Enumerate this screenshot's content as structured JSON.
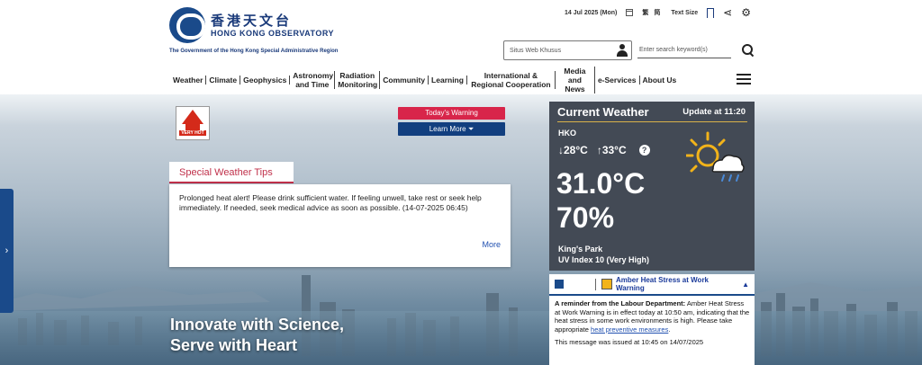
{
  "header": {
    "logo_cn": "香港天文台",
    "logo_en": "HONG KONG OBSERVATORY",
    "gov_line": "The Government of the Hong Kong Special Administrative Region",
    "date": "14 Jul 2025 (Mon)",
    "lang": "繁 简",
    "text_size": "Text Size",
    "site_search_placeholder": "Situs Web Khusus",
    "keyword_search_placeholder": "Enter search keyword(s)"
  },
  "nav": [
    "Weather",
    "Climate",
    "Geophysics",
    "Astronomy and Time",
    "Radiation Monitoring",
    "Community",
    "Learning",
    "International & Regional Cooperation",
    "Media and News",
    "e-Services",
    "About Us"
  ],
  "warning": {
    "icon_label": "VERY HOT",
    "todays_warning": "Today's Warning",
    "learn_more": "Learn More ⏷"
  },
  "tips": {
    "title": "Special Weather Tips",
    "text": "Prolonged heat alert! Please drink sufficient water. If feeling unwell, take rest or seek help immediately. If needed, seek medical advice as soon as possible. (14-07-2025 06:45)",
    "more": "More"
  },
  "slogan": {
    "line1": "Innovate with Science,",
    "line2": "Serve with Heart"
  },
  "weather": {
    "title": "Current Weather",
    "update": "Update at 11:20",
    "location": "HKO",
    "min": "↓28°C",
    "max": "↑33°C",
    "temperature": "31.0°C",
    "humidity": "70%",
    "station": "King's Park",
    "uv": "UV Index 10 (Very High)",
    "icon": "sun-cloud-rain-icon"
  },
  "notice": {
    "title": "Amber Heat Stress at Work Warning",
    "body_bold": "A reminder from the Labour Department:",
    "body": " Amber Heat Stress at Work Warning is in effect today at 10:50 am, indicating that the heat stress in some work environments is high. Please take appropriate ",
    "link": "heat preventive measures",
    "body_end": ".",
    "issued": "This message was issued at 10:45 on 14/07/2025"
  },
  "colors": {
    "brand": "#1a4a8a",
    "warning_red": "#d8254a",
    "panel": "#434a55",
    "accent_gold": "#d8b24a"
  }
}
